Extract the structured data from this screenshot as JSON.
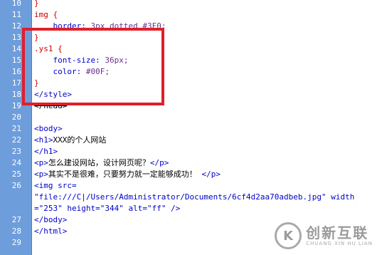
{
  "editor": {
    "lines": [
      {
        "n": "10",
        "parts": [
          {
            "cls": "c-brace",
            "t": "}"
          }
        ]
      },
      {
        "n": "11",
        "parts": [
          {
            "cls": "c-sel",
            "t": "img {"
          }
        ]
      },
      {
        "n": "12",
        "parts": [
          {
            "cls": "c-prop",
            "t": "    border: "
          },
          {
            "cls": "c-val",
            "t": "3px dotted #3F0;"
          }
        ]
      },
      {
        "n": "13",
        "parts": [
          {
            "cls": "c-brace",
            "t": "}"
          }
        ]
      },
      {
        "n": "14",
        "parts": [
          {
            "cls": "c-sel",
            "t": ".ys1 {"
          }
        ]
      },
      {
        "n": "15",
        "parts": [
          {
            "cls": "c-prop",
            "t": "    font-size: "
          },
          {
            "cls": "c-val",
            "t": "36px;"
          }
        ]
      },
      {
        "n": "16",
        "parts": [
          {
            "cls": "c-prop",
            "t": "    color: "
          },
          {
            "cls": "c-val",
            "t": "#00F;"
          }
        ]
      },
      {
        "n": "17",
        "parts": [
          {
            "cls": "c-brace",
            "t": "}"
          }
        ]
      },
      {
        "n": "18",
        "parts": [
          {
            "cls": "c-tag",
            "t": "</style>"
          }
        ]
      },
      {
        "n": "19",
        "parts": [
          {
            "cls": "c-strike",
            "t": "</head>"
          }
        ]
      },
      {
        "n": "20",
        "parts": []
      },
      {
        "n": "21",
        "parts": [
          {
            "cls": "c-tag",
            "t": "<body>"
          }
        ]
      },
      {
        "n": "22",
        "parts": [
          {
            "cls": "c-tag",
            "t": "<h1>"
          },
          {
            "cls": "c-text",
            "t": "XXX的个人网站"
          }
        ]
      },
      {
        "n": "23",
        "parts": [
          {
            "cls": "c-tag",
            "t": "</h1>"
          }
        ]
      },
      {
        "n": "24",
        "parts": [
          {
            "cls": "c-tag",
            "t": "<p>"
          },
          {
            "cls": "c-text",
            "t": "怎么建设网站，设计网页呢？"
          },
          {
            "cls": "c-tag",
            "t": "</p>"
          }
        ]
      },
      {
        "n": "25",
        "parts": [
          {
            "cls": "c-tag",
            "t": "<p>"
          },
          {
            "cls": "c-text",
            "t": "其实不是很难，只要努力就一定能够成功！"
          },
          {
            "cls": "c-tag",
            "t": " </p>"
          }
        ]
      },
      {
        "n": "26",
        "parts": [
          {
            "cls": "c-tag",
            "t": "<img src="
          }
        ]
      },
      {
        "n": "",
        "parts": [
          {
            "cls": "c-str",
            "t": "\"file:///C|/Users/Administrator/Documents/6cf4d2aa70adbeb.jpg\""
          },
          {
            "cls": "c-tag",
            "t": " width"
          }
        ]
      },
      {
        "n": "",
        "parts": [
          {
            "cls": "c-tag",
            "t": "="
          },
          {
            "cls": "c-str",
            "t": "\"253\""
          },
          {
            "cls": "c-tag",
            "t": " height="
          },
          {
            "cls": "c-str",
            "t": "\"344\""
          },
          {
            "cls": "c-tag",
            "t": " alt="
          },
          {
            "cls": "c-str",
            "t": "\"ff\""
          },
          {
            "cls": "c-tag",
            "t": " />"
          }
        ]
      },
      {
        "n": "27",
        "parts": [
          {
            "cls": "c-tag",
            "t": "</body>"
          }
        ]
      },
      {
        "n": "28",
        "parts": [
          {
            "cls": "c-tag",
            "t": "</html>"
          }
        ]
      },
      {
        "n": "29",
        "parts": []
      }
    ]
  },
  "colors": {
    "gutter": "#6e9ddb",
    "highlight_box": "#e01f2a",
    "tag": "#0000cc",
    "selector": "#cc0000",
    "value": "#6b2f8f"
  },
  "watermark": {
    "logo_glyph": "K",
    "chinese": "创新互联",
    "english": "CHUANG XIN HU LIAN"
  }
}
